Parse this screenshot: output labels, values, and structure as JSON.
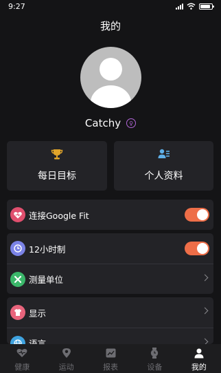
{
  "status_bar": {
    "time": "9:27",
    "battery_level": 0.85
  },
  "header": {
    "title": "我的"
  },
  "profile": {
    "username": "Catchy",
    "gender_icon": "female-icon"
  },
  "cards": [
    {
      "label": "每日目标",
      "icon": "trophy-icon",
      "icon_color": "#e0a42a"
    },
    {
      "label": "个人资料",
      "icon": "profile-card-icon",
      "icon_color": "#5fb0e8"
    }
  ],
  "settings": {
    "google_fit": {
      "label": "连接Google Fit",
      "icon": "heart-icon",
      "icon_color": "#e04f6e",
      "enabled": true
    },
    "hour_format": {
      "label": "12小时制",
      "icon": "clock-icon",
      "icon_color": "#7b83e6",
      "enabled": true
    },
    "units": {
      "label": "测量单位",
      "icon": "ruler-icon",
      "icon_color": "#3bb76a"
    },
    "display": {
      "label": "显示",
      "icon": "shirt-icon",
      "icon_color": "#e8647c"
    },
    "language": {
      "label": "语言",
      "icon": "globe-icon",
      "icon_color": "#3fa3e0"
    }
  },
  "toggle_color": "#ee6e48",
  "tabs": [
    {
      "label": "健康",
      "icon": "heart-tab-icon",
      "active": false
    },
    {
      "label": "运动",
      "icon": "location-tab-icon",
      "active": false
    },
    {
      "label": "报表",
      "icon": "chart-tab-icon",
      "active": false
    },
    {
      "label": "设备",
      "icon": "watch-tab-icon",
      "active": false
    },
    {
      "label": "我的",
      "icon": "person-tab-icon",
      "active": true
    }
  ]
}
